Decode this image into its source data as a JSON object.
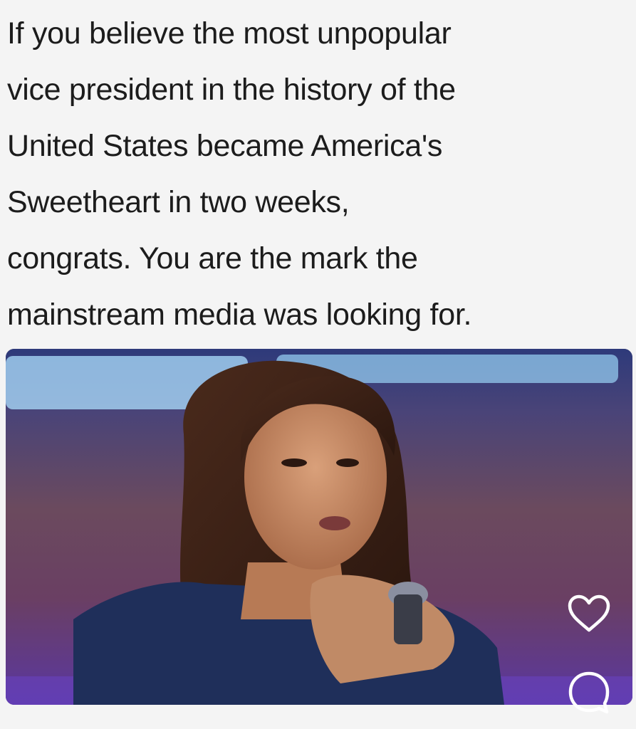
{
  "post": {
    "text": "If you believe the most unpopular\nvice president in the history of the\nUnited States became America's\nSweetheart in two weeks,\ncongrats. You are the mark the\nmainstream media was looking for."
  },
  "photo": {
    "subject": "woman speaking into microphone on stage"
  },
  "actions": {
    "like_icon": "heart-icon",
    "comment_icon": "comment-icon"
  },
  "colors": {
    "background": "#f4f4f4",
    "text": "#1c1c1c",
    "stage_purple": "#5a3f8c",
    "icon_stroke": "#ffffff"
  }
}
